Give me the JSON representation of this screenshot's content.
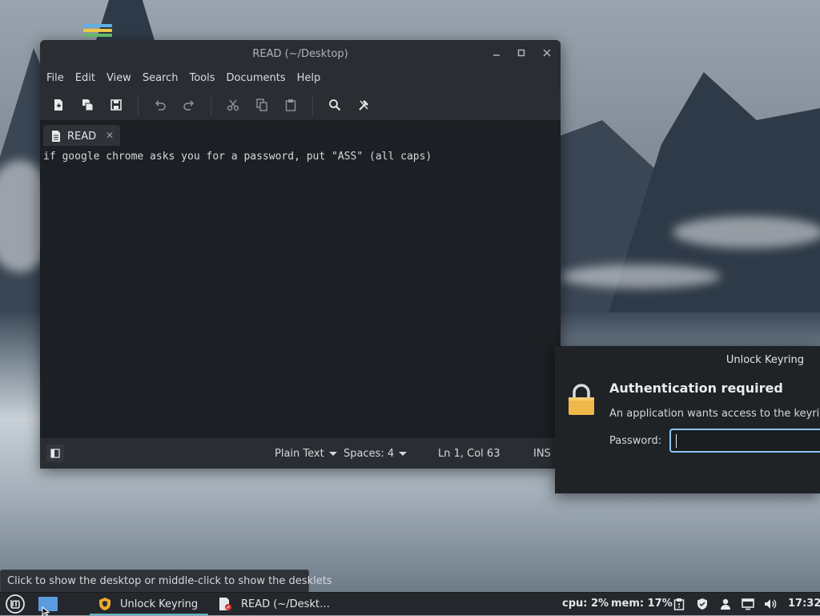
{
  "editor": {
    "window_title": "READ (~/Desktop)",
    "menu": [
      "File",
      "Edit",
      "View",
      "Search",
      "Tools",
      "Documents",
      "Help"
    ],
    "tab_label": "READ",
    "content_line": "if google chrome asks you for a password, put \"ASS\" (all caps)",
    "status": {
      "syntax": "Plain Text",
      "indent": "Spaces: 4",
      "position": "Ln 1, Col 63",
      "mode": "INS"
    }
  },
  "dialog": {
    "title": "Unlock Keyring",
    "heading": "Authentication required",
    "message": "An application wants access to the keyring “",
    "password_label": "Password:",
    "password_value": ""
  },
  "tooltip": "Click to show the desktop or middle-click to show the desklets",
  "taskbar": {
    "tasks": [
      {
        "label": "Unlock Keyring",
        "active": true
      },
      {
        "label": "READ (~/Deskt…",
        "active": false
      }
    ],
    "cpu": "cpu: 2%",
    "mem": "mem: 17%",
    "clock": "17:32"
  },
  "colors": {
    "accent": "#5fb1c4",
    "focus_border": "#8ec3f0",
    "lock_body": "#f0b84a"
  }
}
